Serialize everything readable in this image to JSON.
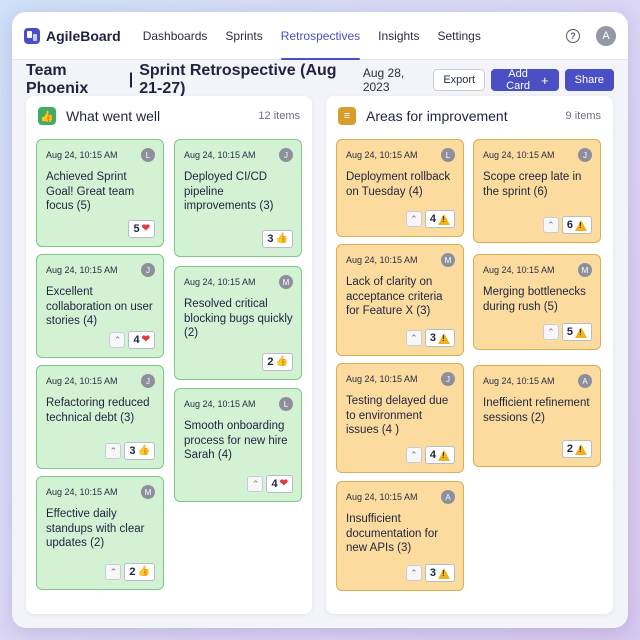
{
  "app": {
    "name": "AgileBoard",
    "avatar": "A",
    "help": "?"
  },
  "nav": {
    "items": [
      {
        "label": "Dashboards"
      },
      {
        "label": "Sprints"
      },
      {
        "label": "Retrospectives"
      },
      {
        "label": "Insights"
      },
      {
        "label": "Settings"
      }
    ],
    "active": "Retrospectives"
  },
  "header": {
    "team": "Team Phoenix",
    "separator": "|",
    "title": "Sprint Retrospective (Aug 21-27)",
    "date": "Aug 28, 2023",
    "export_label": "Export",
    "add_card_label": "Add Card",
    "share_label": "Share"
  },
  "colors": {
    "accent": "#4a4fc4",
    "well_card": "#d3f1d3",
    "improve_card": "#fcdc9e"
  },
  "columns": {
    "well": {
      "title": "What went well",
      "count": "12 items",
      "icon": "thumbs-up-icon",
      "cards": [
        {
          "time": "Aug 24, 10:15 AM",
          "avatar": "L",
          "text": "Achieved Sprint Goal! Great team focus (5)",
          "votes": "5",
          "emoji": "heart"
        },
        {
          "time": "Aug 24, 10:15 AM",
          "avatar": "J",
          "text": "Deployed CI/CD pipeline improvements (3)",
          "votes": "3",
          "emoji": "thumbs"
        },
        {
          "time": "Aug 24, 10:15 AM",
          "avatar": "J",
          "text": "Excellent collaboration on user stories (4)",
          "votes": "4",
          "emoji": "heart"
        },
        {
          "time": "Aug 24, 10:15 AM",
          "avatar": "M",
          "text": "Resolved critical blocking bugs quickly (2)",
          "votes": "2",
          "emoji": "thumbs"
        },
        {
          "time": "Aug 24, 10:15 AM",
          "avatar": "J",
          "text": "Refactoring reduced technical debt (3)",
          "votes": "3",
          "emoji": "thumbs"
        },
        {
          "time": "Aug 24, 10:15 AM",
          "avatar": "L",
          "text": "Smooth onboarding process for new hire Sarah (4)",
          "votes": "4",
          "emoji": "heart"
        },
        {
          "time": "Aug 24, 10:15 AM",
          "avatar": "M",
          "text": "Effective daily standups with clear updates (2)",
          "votes": "2",
          "emoji": "thumbs"
        }
      ]
    },
    "improve": {
      "title": "Areas for improvement",
      "count": "9 items",
      "icon": "list-icon",
      "cards": [
        {
          "time": "Aug 24, 10:15 AM",
          "avatar": "L",
          "text": "Deployment rollback on Tuesday (4)",
          "votes": "4"
        },
        {
          "time": "Aug 24, 10:15 AM",
          "avatar": "J",
          "text": "Scope creep late in the sprint (6)",
          "votes": "6"
        },
        {
          "time": "Aug 24, 10:15 AM",
          "avatar": "M",
          "text": "Lack of clarity on acceptance criteria for Feature X (3)",
          "votes": "3"
        },
        {
          "time": "Aug 24, 10:15 AM",
          "avatar": "M",
          "text": "Merging bottlenecks during rush (5)",
          "votes": "5"
        },
        {
          "time": "Aug 24, 10:15 AM",
          "avatar": "J",
          "text": "Testing delayed due to environment issues (4 )",
          "votes": "4"
        },
        {
          "time": "Aug 24, 10:15 AM",
          "avatar": "A",
          "text": "Inefficient refinement sessions (2)",
          "votes": "2"
        },
        {
          "time": "Aug 24, 10:15 AM",
          "avatar": "A",
          "text": "Insufficient documentation for new APIs (3)",
          "votes": "3"
        }
      ]
    }
  }
}
